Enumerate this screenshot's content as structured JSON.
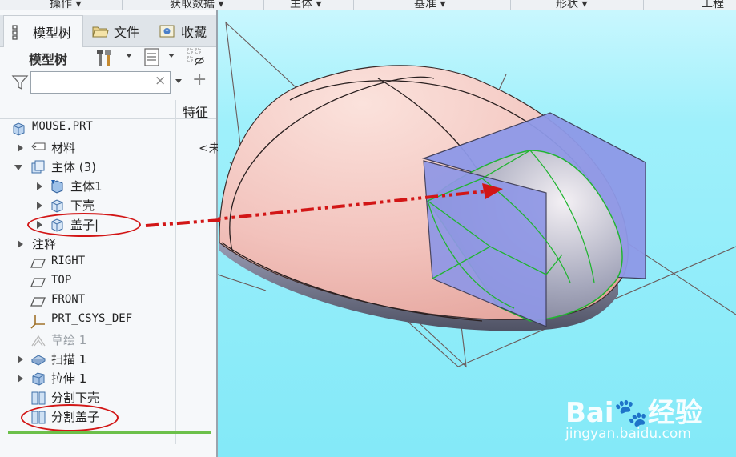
{
  "ribbon": {
    "groups": [
      "操作 ▾",
      "获取数据 ▾",
      "主体 ▾",
      "基准 ▾",
      "形状 ▾",
      "工程"
    ]
  },
  "tabs": [
    {
      "label": "模型树",
      "icon": "model-tree-icon"
    },
    {
      "label": "文件",
      "icon": "folder-icon"
    },
    {
      "label": "收藏",
      "icon": "favorites-icon"
    }
  ],
  "tree_toolbar": {
    "title": "模型树"
  },
  "filter": {
    "value": "",
    "clear_symbol": "×",
    "add_symbol": "+"
  },
  "columns": {
    "feature": "特征",
    "clipped_value": "<未"
  },
  "tree": {
    "root": "MOUSE.PRT",
    "material": "材料",
    "bodies": "主体 (3)",
    "body1": "主体1",
    "lower_shell": "下壳",
    "cover": "盖子|",
    "annotations": "注释",
    "right": "RIGHT",
    "top": "TOP",
    "front": "FRONT",
    "csys": "PRT_CSYS_DEF",
    "sketch": "草绘 1",
    "sweep": "扫描 1",
    "extrude": "拉伸 1",
    "split_lower": "分割下壳",
    "split_cover": "分割盖子"
  },
  "colors": {
    "viewport_bg": "#83e9f8",
    "mouse_body": "#f2c2bc",
    "mouse_underside": "#7c7f99",
    "cut_plane": "#8e99e8",
    "highlight_green": "#21b531",
    "annotation_red": "#d21616"
  },
  "watermark": {
    "logo": "Bai🐾经验",
    "url": "jingyan.baidu.com"
  }
}
